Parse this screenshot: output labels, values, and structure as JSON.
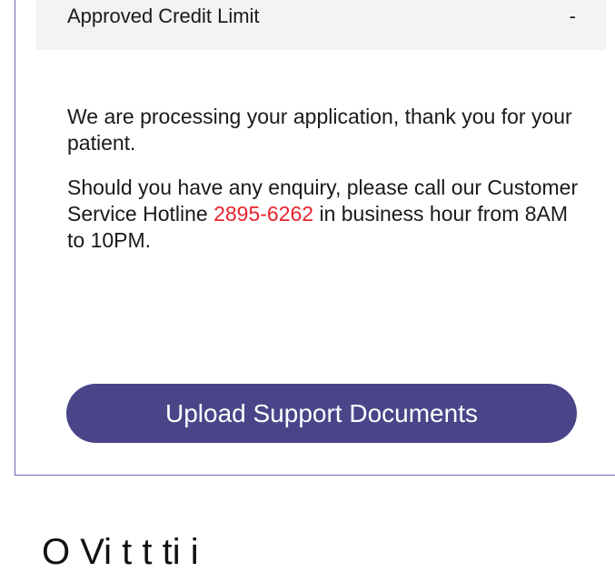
{
  "credit_limit": {
    "label": "Approved Credit Limit",
    "value": "-"
  },
  "message": {
    "line1": "We are processing your application, thank you for your patient.",
    "enquiry_prefix": "Should you have any enquiry, please call our Customer Service Hotline ",
    "hotline_number": "2895-6262",
    "enquiry_suffix": " in business hour from 8AM to 10PM."
  },
  "actions": {
    "upload_label": "Upload Support Documents"
  },
  "next_section": {
    "heading_partial": "O   Vi   t                    t    ti   i"
  },
  "colors": {
    "primary": "#4a4589",
    "hotline": "#e8232c",
    "row_background": "#f3f3f3",
    "card_border": "#6b66a8"
  }
}
